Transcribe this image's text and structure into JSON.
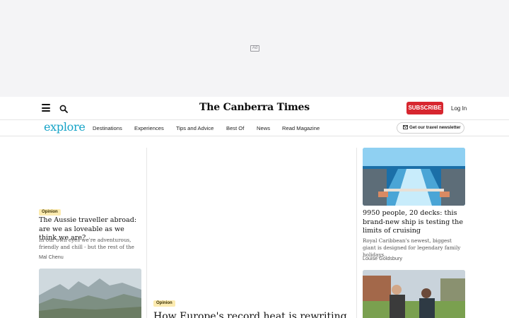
{
  "ad": {
    "label": "Ad"
  },
  "header": {
    "brand": "The Canberra Times",
    "subscribe_label": "SUBSCRIBE",
    "login_label": "Log In",
    "accent_color": "#d7262f"
  },
  "nav": {
    "logo": "explore",
    "logo_color": "#15a3c7",
    "items": [
      "Destinations",
      "Experiences",
      "Tips and Advice",
      "Best Of",
      "News",
      "Read Magazine"
    ],
    "newsletter_label": "Get our travel newsletter"
  },
  "articles": {
    "left": {
      "tag": "Opinion",
      "headline": "The Aussie traveller abroad: are we as loveable as we think we are?",
      "summary": "In our own eyes we're adventurous, friendly and chill - but the rest of the world may not...",
      "author": "Mal Chenu"
    },
    "center": {
      "tag": "Opinion",
      "headline": "How Europe's record heat is rewriting the"
    },
    "right": {
      "headline": "9950 people, 20 decks: this brand-new ship is testing the limits of cruising",
      "summary": "Royal Caribbean's newest, biggest giant is designed for legendary family holidays.",
      "author": "Louise Goldsbury"
    }
  }
}
